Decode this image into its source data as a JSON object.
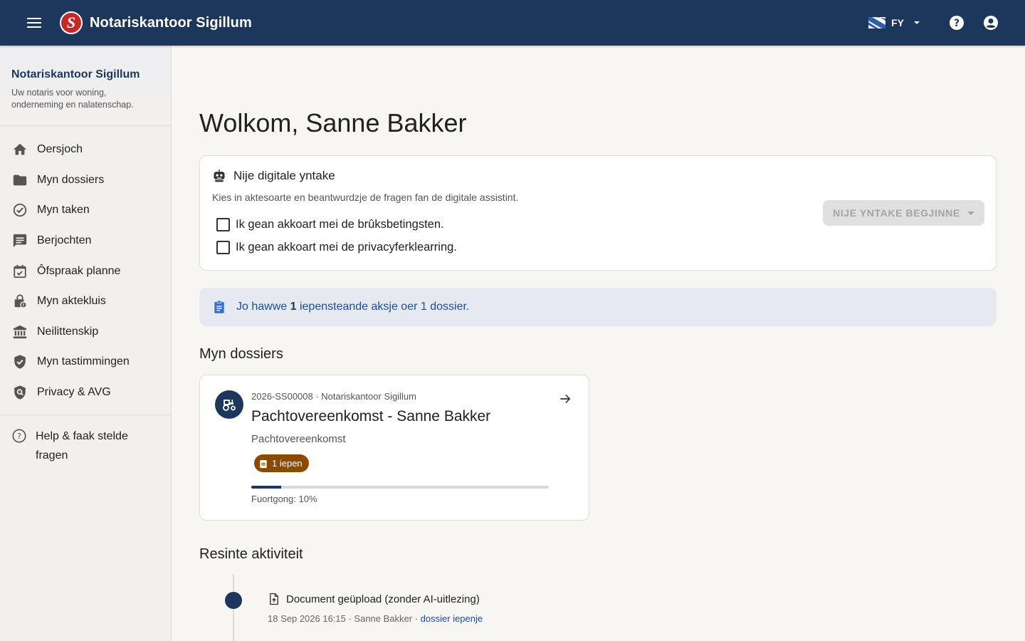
{
  "header": {
    "logo_letter": "S",
    "app_title": "Notariskantoor Sigillum",
    "language_code": "FY"
  },
  "sidebar": {
    "title": "Notariskantoor Sigillum",
    "subtitle": "Uw notaris voor woning, onderneming en nalatenschap.",
    "items": [
      {
        "label": "Oersjoch",
        "icon": "home-icon"
      },
      {
        "label": "Myn dossiers",
        "icon": "folder-icon"
      },
      {
        "label": "Myn taken",
        "icon": "check-circle-icon"
      },
      {
        "label": "Berjochten",
        "icon": "message-icon"
      },
      {
        "label": "Ôfspraak planne",
        "icon": "calendar-check-icon"
      },
      {
        "label": "Myn aktekluis",
        "icon": "lock-icon"
      },
      {
        "label": "Neilittenskip",
        "icon": "bank-icon"
      },
      {
        "label": "Myn tastimmingen",
        "icon": "shield-check-icon"
      },
      {
        "label": "Privacy & AVG",
        "icon": "shield-search-icon"
      }
    ],
    "help_label": "Help & faak stelde fragen"
  },
  "main": {
    "welcome": "Wolkom, Sanne Bakker",
    "intake": {
      "title": "Nije digitale yntake",
      "description": "Kies in aktesoarte en beantwurdzje de fragen fan de digitale assistint.",
      "terms_label": "Ik gean akkoart mei de brûksbetingsten.",
      "privacy_label": "Ik gean akkoart mei de privacyferklearring.",
      "start_button": "NIJE YNTAKE BEGJINNE"
    },
    "alert": {
      "prefix": "Jo hawwe",
      "count": "1",
      "suffix": "iepensteande aksje oer 1 dossier."
    },
    "dossiers_title": "Myn dossiers",
    "dossier": {
      "meta": "2026-SS00008 · Notariskantoor Sigillum",
      "title": "Pachtovereenkomst - Sanne Bakker",
      "type": "Pachtovereenkomst",
      "badge": "1 iepen",
      "progress": 0.1,
      "progress_label": "Fuortgong: 10%"
    },
    "activity_title": "Resinte aktiviteit",
    "activity": {
      "title": "Document geüpload (zonder AI-uitlezing)",
      "meta": "18 Sep 2026 16:15 · Sanne Bakker ·",
      "link": "dossier iepenje"
    }
  },
  "colors": {
    "primary": "#1c365c",
    "brand_red": "#c62828",
    "badge": "#8a4b00",
    "alert_bg": "#e6eaf0",
    "link": "#1c4e9c"
  }
}
